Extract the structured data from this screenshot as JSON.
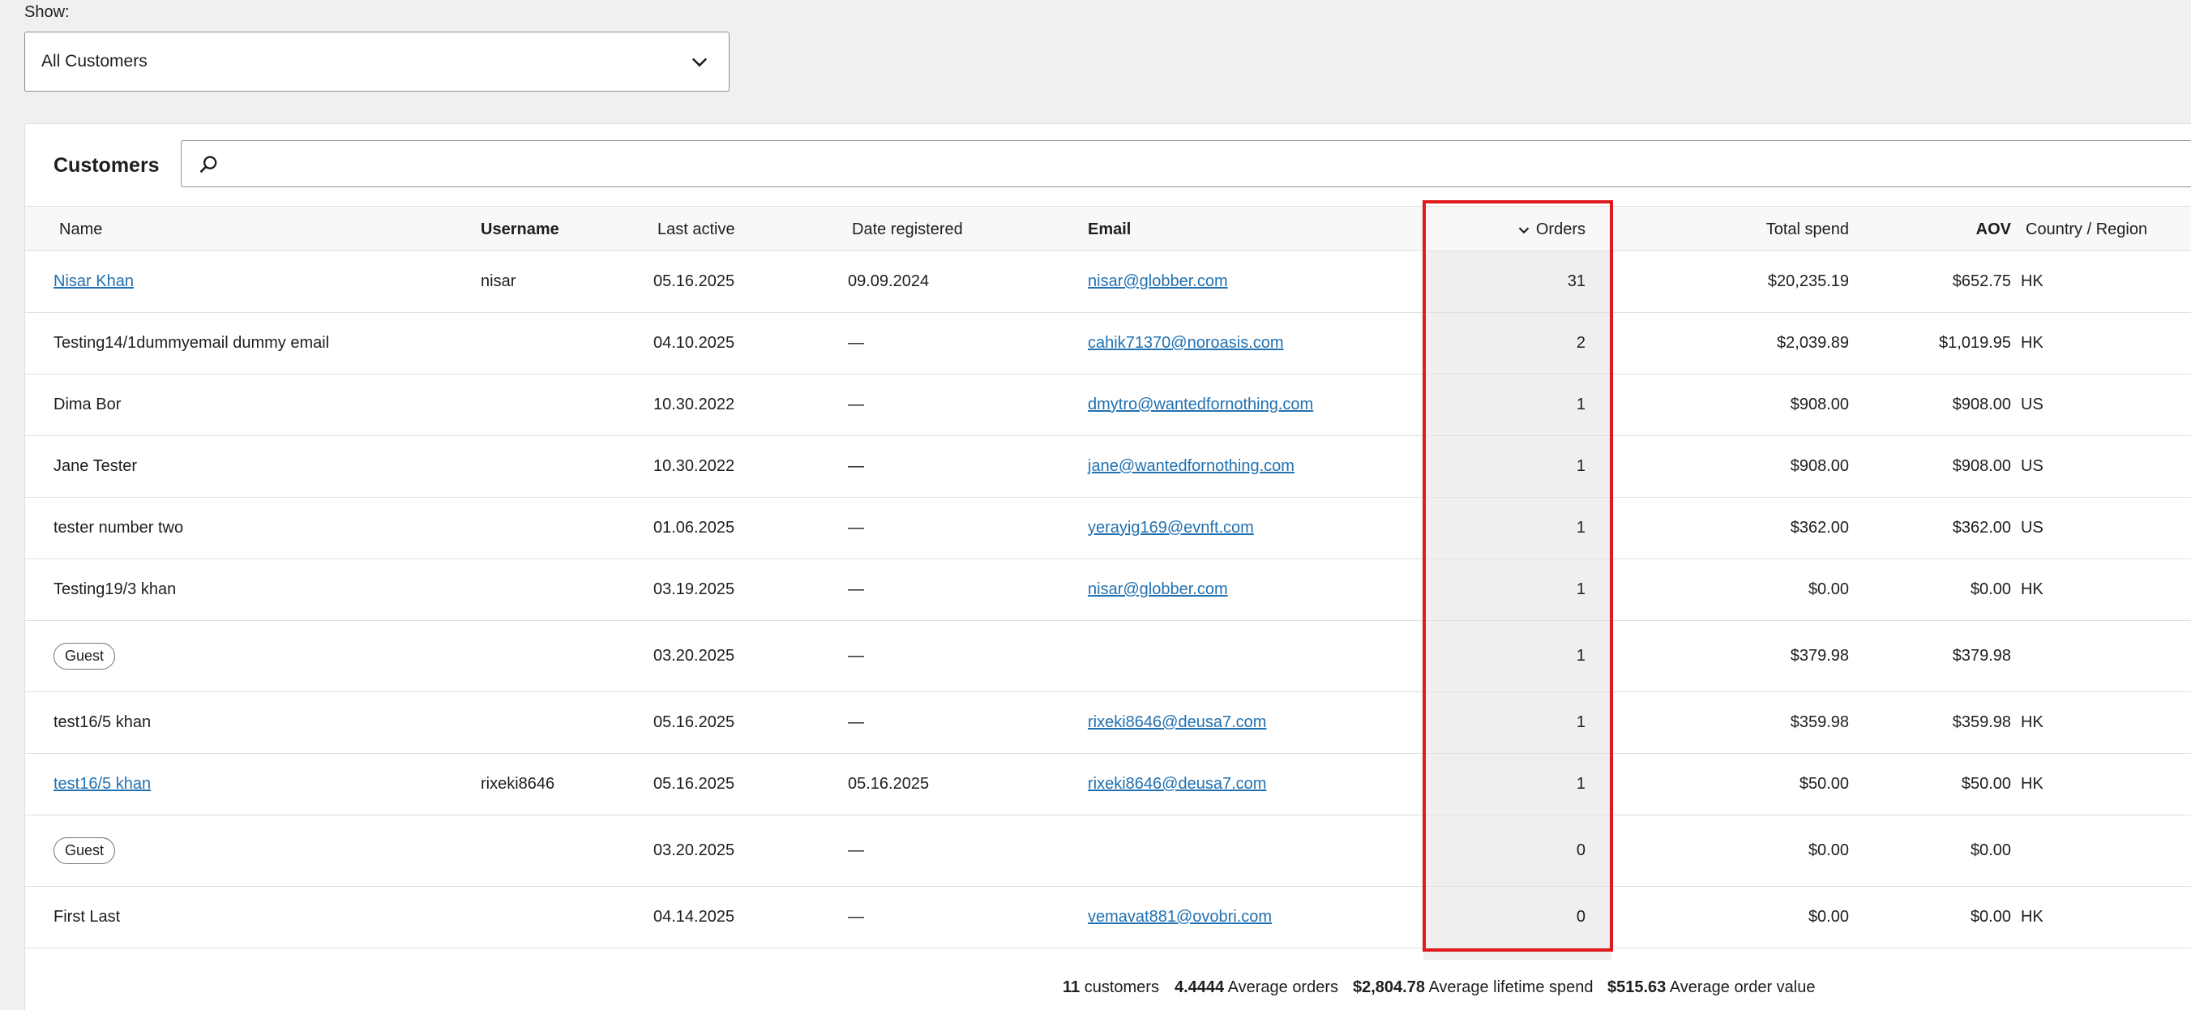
{
  "filter": {
    "label": "Show:",
    "selected": "All Customers"
  },
  "panel": {
    "title": "Customers",
    "search_placeholder": ""
  },
  "columns": {
    "name": "Name",
    "username": "Username",
    "last_active": "Last active",
    "date_registered": "Date registered",
    "email": "Email",
    "orders": "Orders",
    "total_spend": "Total spend",
    "aov": "AOV",
    "country": "Country / Region"
  },
  "rows": [
    {
      "name": "Nisar Khan",
      "username": "nisar",
      "last_active": "05.16.2025",
      "date_registered": "09.09.2024",
      "email": "nisar@globber.com",
      "orders": "31",
      "total_spend": "$20,235.19",
      "aov": "$652.75",
      "country": "HK"
    },
    {
      "name": "Testing14/1dummyemail dummy email",
      "username": "",
      "last_active": "04.10.2025",
      "date_registered": "—",
      "email": "cahik71370@noroasis.com",
      "orders": "2",
      "total_spend": "$2,039.89",
      "aov": "$1,019.95",
      "country": "HK"
    },
    {
      "name": "Dima Bor",
      "username": "",
      "last_active": "10.30.2022",
      "date_registered": "—",
      "email": "dmytro@wantedfornothing.com",
      "orders": "1",
      "total_spend": "$908.00",
      "aov": "$908.00",
      "country": "US"
    },
    {
      "name": "Jane Tester",
      "username": "",
      "last_active": "10.30.2022",
      "date_registered": "—",
      "email": "jane@wantedfornothing.com",
      "orders": "1",
      "total_spend": "$908.00",
      "aov": "$908.00",
      "country": "US"
    },
    {
      "name": "tester number two",
      "username": "",
      "last_active": "01.06.2025",
      "date_registered": "—",
      "email": "yerayig169@evnft.com",
      "orders": "1",
      "total_spend": "$362.00",
      "aov": "$362.00",
      "country": "US"
    },
    {
      "name": "Testing19/3 khan",
      "username": "",
      "last_active": "03.19.2025",
      "date_registered": "—",
      "email": "nisar@globber.com",
      "orders": "1",
      "total_spend": "$0.00",
      "aov": "$0.00",
      "country": "HK"
    },
    {
      "name": "Guest",
      "username": "",
      "last_active": "03.20.2025",
      "date_registered": "—",
      "email": "",
      "orders": "1",
      "total_spend": "$379.98",
      "aov": "$379.98",
      "country": ""
    },
    {
      "name": "test16/5 khan",
      "username": "",
      "last_active": "05.16.2025",
      "date_registered": "—",
      "email": "rixeki8646@deusa7.com",
      "orders": "1",
      "total_spend": "$359.98",
      "aov": "$359.98",
      "country": "HK"
    },
    {
      "name": "test16/5 khan",
      "username": "rixeki8646",
      "last_active": "05.16.2025",
      "date_registered": "05.16.2025",
      "email": "rixeki8646@deusa7.com",
      "orders": "1",
      "total_spend": "$50.00",
      "aov": "$50.00",
      "country": "HK"
    },
    {
      "name": "Guest",
      "username": "",
      "last_active": "03.20.2025",
      "date_registered": "—",
      "email": "",
      "orders": "0",
      "total_spend": "$0.00",
      "aov": "$0.00",
      "country": ""
    },
    {
      "name": "First Last",
      "username": "",
      "last_active": "04.14.2025",
      "date_registered": "—",
      "email": "vemavat881@ovobri.com",
      "orders": "0",
      "total_spend": "$0.00",
      "aov": "$0.00",
      "country": "HK"
    }
  ],
  "summary": {
    "customers_count": "11",
    "customers_label": "customers",
    "avg_orders": "4.4444",
    "avg_orders_label": "Average orders",
    "avg_lifetime_spend": "$2,804.78",
    "avg_lifetime_spend_label": "Average lifetime spend",
    "avg_order_value": "$515.63",
    "avg_order_value_label": "Average order value"
  },
  "colors": {
    "link": "#2271b1",
    "highlight": "#e0191f",
    "sorted_column_bg": "#efefef"
  },
  "icons": {
    "dropdown": "chevron-down-icon",
    "search": "search-icon",
    "sort": "sort-desc-icon"
  }
}
